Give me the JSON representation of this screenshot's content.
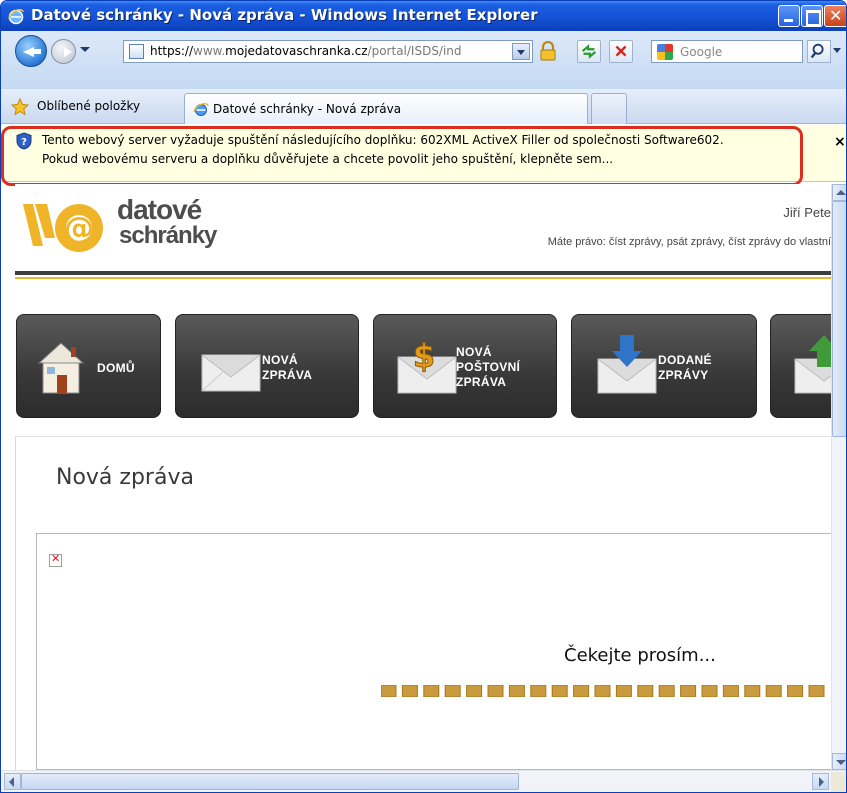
{
  "window": {
    "title": "Datové schránky - Nová zpráva - Windows Internet Explorer"
  },
  "address_bar": {
    "url_scheme": "https://",
    "url_host_prefix": "www.",
    "url_host_domain": "mojedatovaschranka.cz",
    "url_path": "/portal/ISDS/ind",
    "search_placeholder": "Google"
  },
  "favorites_bar": {
    "favorites_label": "Oblíbené položky",
    "active_tab_label": "Datové schránky - Nová zpráva"
  },
  "infobar": {
    "line1": "Tento webový server vyžaduje spuštění následujícího doplňku: 602XML ActiveX Filler od společnosti Software602.",
    "line2": "Pokud webovému serveru a doplňku důvěřujete a chcete povolit jeho spuštění, klepněte sem...",
    "close_glyph": "×"
  },
  "header": {
    "brand_line1": "datové",
    "brand_line2": "schránky",
    "user_name": "Jiří Pete",
    "rights": "Máte právo: číst zprávy, psát zprávy, číst zprávy do vlastní"
  },
  "nav": [
    {
      "icon": "house-icon",
      "line1": "DOMŮ",
      "line2": "",
      "line3": ""
    },
    {
      "icon": "envelope-icon",
      "line1": "NOVÁ",
      "line2": "ZPRÁVA",
      "line3": ""
    },
    {
      "icon": "money-envelope-icon",
      "line1": "NOVÁ",
      "line2": "POŠTOVNÍ",
      "line3": "ZPRÁVA"
    },
    {
      "icon": "inbox-download-icon",
      "line1": "DODANÉ",
      "line2": "ZPRÁVY",
      "line3": ""
    },
    {
      "icon": "outbox-upload-icon",
      "line1": "",
      "line2": "",
      "line3": ""
    }
  ],
  "main": {
    "page_title": "Nová zpráva",
    "wait_text": "Čekejte prosím..."
  },
  "colors": {
    "ie_blue": "#1452d6",
    "infobar_bg": "#ffffe1",
    "highlight_outline": "#dc2d1f",
    "brand_orange": "#f0b428",
    "nav_tile": "#3d3d3d",
    "progress_block": "#c99a3e"
  }
}
